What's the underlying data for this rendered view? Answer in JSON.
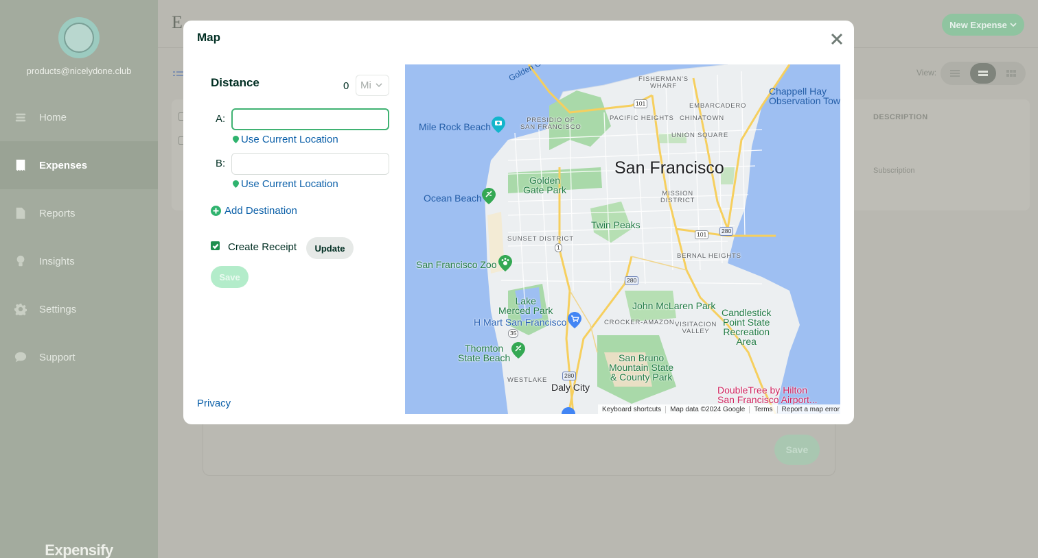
{
  "sidebar": {
    "user_email": "products@nicelydone.club",
    "items": [
      {
        "label": "Home",
        "icon": "home-icon"
      },
      {
        "label": "Expenses",
        "icon": "receipt-icon",
        "active": true
      },
      {
        "label": "Reports",
        "icon": "document-icon"
      },
      {
        "label": "Insights",
        "icon": "lightbulb-icon"
      },
      {
        "label": "Settings",
        "icon": "gear-icon"
      },
      {
        "label": "Support",
        "icon": "chat-icon"
      }
    ],
    "brand": "Expensify"
  },
  "background": {
    "title": "E",
    "new_expense_label": "New Expense",
    "view_label": "View:",
    "table_header_description": "DESCRIPTION",
    "cell_description": "Subscription",
    "save_label": "Save"
  },
  "modal": {
    "title": "Map",
    "distance_label": "Distance",
    "distance_value": "0",
    "unit": "Mi",
    "waypoint_a_label": "A:",
    "waypoint_a_value": "",
    "waypoint_b_label": "B:",
    "waypoint_b_value": "",
    "use_current_location": "Use Current Location",
    "add_destination": "Add Destination",
    "create_receipt_label": "Create Receipt",
    "create_receipt_checked": true,
    "update_label": "Update",
    "save_label": "Save",
    "privacy_label": "Privacy"
  },
  "map": {
    "city": "San Francisco",
    "labels": {
      "golden_gate": "Golden Gate",
      "fishermans_wharf": "FISHERMAN'S\nWHARF",
      "chappell": "Chappell Hay\nObservation Tow",
      "embarcadero": "EMBARCADERO",
      "presidio": "PRESIDIO OF\nSAN FRANCISCO",
      "pacific_heights": "PACIFIC HEIGHTS",
      "chinatown": "CHINATOWN",
      "mile_rock": "Mile Rock Beach",
      "union_square": "UNION SQUARE",
      "gg_park": "Golden\nGate Park",
      "mission": "MISSION\nDISTRICT",
      "ocean_beach": "Ocean Beach",
      "twin_peaks": "Twin Peaks",
      "sunset": "SUNSET DISTRICT",
      "bernal": "BERNAL HEIGHTS",
      "sf_zoo": "San Francisco Zoo",
      "lake_merced": "Lake\nMerced Park",
      "john_mclaren": "John McLaren Park",
      "candlestick": "Candlestick\nPoint State\nRecreation\nArea",
      "h_mart": "H Mart San Francisco",
      "crocker": "CROCKER-AMAZON",
      "visitacion": "VISITACION\nVALLEY",
      "thornton": "Thornton\nState Beach",
      "san_bruno": "San Bruno\nMountain State\n& County Park",
      "westlake": "WESTLAKE",
      "daly_city": "Daly City",
      "doubletree": "DoubleTree by Hilton\nSan Francisco Airport..."
    },
    "shields": {
      "us101": "101",
      "i280": "280",
      "ca1": "1",
      "ca35": "35"
    },
    "attribution": {
      "keyboard": "Keyboard shortcuts",
      "data": "Map data ©2024 Google",
      "terms": "Terms",
      "report": "Report a map error"
    }
  }
}
